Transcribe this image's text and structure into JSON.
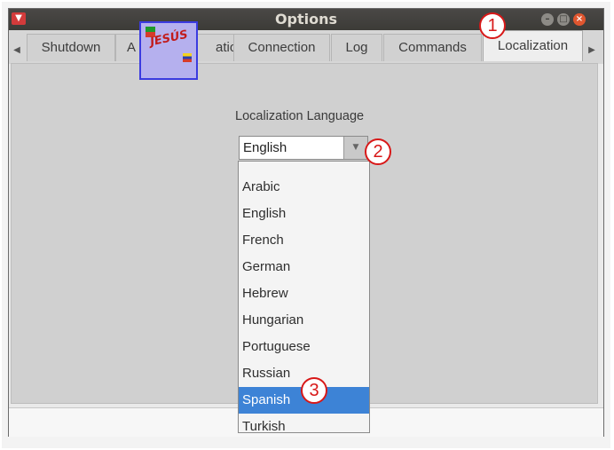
{
  "window": {
    "title": "Options"
  },
  "tabs": [
    {
      "label": "Shutdown"
    },
    {
      "label": "A"
    },
    {
      "label": "ation"
    },
    {
      "label": "Connection"
    },
    {
      "label": "Log"
    },
    {
      "label": "Commands"
    },
    {
      "label": "Localization"
    }
  ],
  "localization": {
    "label": "Localization Language",
    "selected": "English",
    "options": [
      "Arabic",
      "English",
      "French",
      "German",
      "Hebrew",
      "Hungarian",
      "Portuguese",
      "Russian",
      "Spanish",
      "Turkish"
    ],
    "highlighted": "Spanish"
  },
  "annotations": [
    "1",
    "2",
    "3"
  ],
  "logo": {
    "text": "JESÚS"
  },
  "colors": {
    "highlight": "#3d83d6",
    "badge": "#d81818",
    "close_button": "#e0562f"
  }
}
